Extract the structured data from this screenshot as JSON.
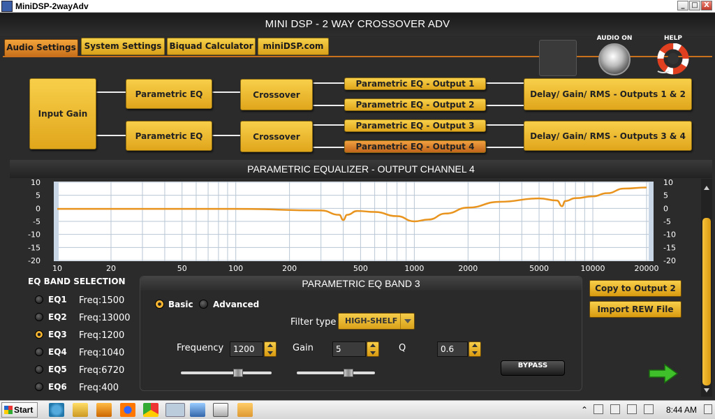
{
  "window": {
    "title": "MiniDSP-2wayAdv",
    "min": "_",
    "max": "□",
    "close": "X"
  },
  "app": {
    "title": "MINI DSP - 2 WAY CROSSOVER ADV"
  },
  "tabs": [
    {
      "label": "Audio Settings",
      "active": true
    },
    {
      "label": "System Settings"
    },
    {
      "label": "Biquad Calculator"
    },
    {
      "label": "miniDSP.com"
    }
  ],
  "header": {
    "audio_on": "AUDIO ON",
    "help": "HELP"
  },
  "routing": {
    "input_gain": "Input Gain",
    "peq1": "Parametric EQ",
    "peq2": "Parametric EQ",
    "xo1": "Crossover",
    "xo2": "Crossover",
    "out1": "Parametric EQ - Output 1",
    "out2": "Parametric EQ - Output 2",
    "out3": "Parametric EQ - Output 3",
    "out4": "Parametric EQ - Output 4",
    "dgr12": "Delay/ Gain/ RMS - Outputs 1 & 2",
    "dgr34": "Delay/ Gain/ RMS - Outputs 3 & 4",
    "selected": "out4"
  },
  "eq_title": "PARAMETRIC EQUALIZER - OUTPUT CHANNEL 4",
  "chart_data": {
    "type": "line",
    "title": "PARAMETRIC EQUALIZER - OUTPUT CHANNEL 4",
    "xlabel": "",
    "ylabel": "",
    "xscale": "log",
    "xlim": [
      10,
      20000
    ],
    "ylim": [
      -20,
      10
    ],
    "x_ticks": [
      10,
      20,
      50,
      100,
      200,
      500,
      1000,
      2000,
      5000,
      10000,
      20000
    ],
    "x_tick_labels": [
      "10",
      "20",
      "50",
      "100",
      "200",
      "500",
      "1000",
      "2000",
      "5000",
      "10000",
      "20000"
    ],
    "y_ticks": [
      10,
      5,
      0,
      -5,
      -10,
      -15,
      -20
    ],
    "y_tick_labels": [
      "10",
      "5",
      "0",
      "-5",
      "-10",
      "-15",
      "-20"
    ],
    "grid": true,
    "line_color": "#e8941e",
    "series": [
      {
        "x": [
          10,
          100,
          300,
          380,
          400,
          420,
          480,
          600,
          800,
          1000,
          1200,
          1500,
          2000,
          3000,
          5000,
          6300,
          6720,
          7000,
          8000,
          10000,
          12000,
          15000,
          20000
        ],
        "values": [
          -0.2,
          -0.2,
          -0.8,
          -2.5,
          -4.5,
          -2.5,
          -1.0,
          -1.4,
          -3.0,
          -5.0,
          -4.3,
          -2.0,
          0.3,
          2.5,
          3.8,
          3.0,
          0.8,
          2.8,
          3.9,
          4.6,
          5.8,
          7.6,
          8.0
        ]
      }
    ]
  },
  "band_selection": {
    "title": "EQ BAND SELECTION",
    "bands": [
      {
        "name": "EQ1",
        "freq": "Freq:1500",
        "selected": false
      },
      {
        "name": "EQ2",
        "freq": "Freq:13000",
        "selected": false
      },
      {
        "name": "EQ3",
        "freq": "Freq:1200",
        "selected": true
      },
      {
        "name": "EQ4",
        "freq": "Freq:1040",
        "selected": false
      },
      {
        "name": "EQ5",
        "freq": "Freq:6720",
        "selected": false
      },
      {
        "name": "EQ6",
        "freq": "Freq:400",
        "selected": false
      }
    ]
  },
  "band_panel": {
    "title": "PARAMETRIC EQ BAND 3",
    "mode_basic": "Basic",
    "mode_advanced": "Advanced",
    "filter_type_label": "Filter type",
    "filter_type": "HIGH-SHELF",
    "frequency_label": "Frequency",
    "frequency": "1200",
    "gain_label": "Gain",
    "gain": "5",
    "q_label": "Q",
    "q": "0.6",
    "bypass": "BYPASS"
  },
  "side_buttons": {
    "copy": "Copy to Output 2",
    "import": "Import REW File"
  },
  "taskbar": {
    "start": "Start",
    "clock": "8:44 AM"
  },
  "colors": {
    "accent": "#f0b42a",
    "selected": "#d47b22",
    "curve": "#e8941e"
  }
}
